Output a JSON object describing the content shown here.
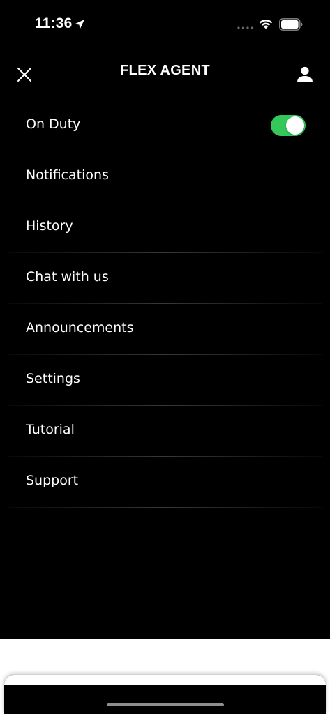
{
  "status_bar": {
    "time": "11:36",
    "location_icon": "location-arrow-icon",
    "signal_icon": "signal-dots-icon",
    "wifi_icon": "wifi-icon",
    "battery_icon": "battery-icon"
  },
  "header": {
    "title": "FLEX AGENT",
    "close_icon": "close-icon",
    "profile_icon": "person-icon"
  },
  "menu": {
    "items": [
      {
        "label": "On Duty",
        "has_toggle": true,
        "toggle_on": true
      },
      {
        "label": "Notifications"
      },
      {
        "label": "History"
      },
      {
        "label": "Chat with us"
      },
      {
        "label": "Announcements"
      },
      {
        "label": "Settings"
      },
      {
        "label": "Tutorial"
      },
      {
        "label": "Support"
      }
    ]
  },
  "colors": {
    "background": "#000000",
    "text": "#ffffff",
    "toggle_on": "#34c759"
  }
}
